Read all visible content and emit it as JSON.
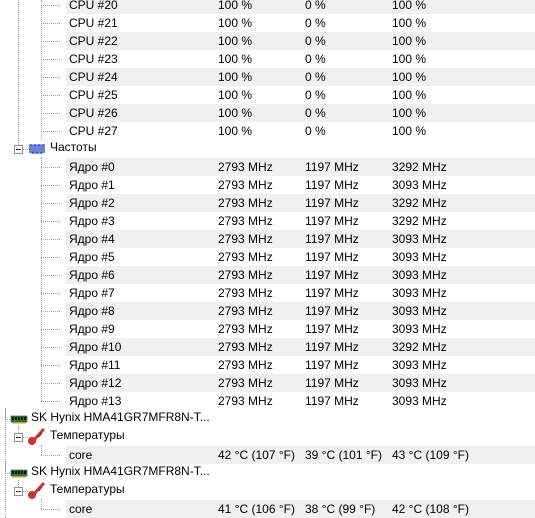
{
  "cpu_rows": [
    {
      "name": "CPU #20",
      "v1": "100 %",
      "v2": "0 %",
      "v3": "100 %"
    },
    {
      "name": "CPU #21",
      "v1": "100 %",
      "v2": "0 %",
      "v3": "100 %"
    },
    {
      "name": "CPU #22",
      "v1": "100 %",
      "v2": "0 %",
      "v3": "100 %"
    },
    {
      "name": "CPU #23",
      "v1": "100 %",
      "v2": "0 %",
      "v3": "100 %"
    },
    {
      "name": "CPU #24",
      "v1": "100 %",
      "v2": "0 %",
      "v3": "100 %"
    },
    {
      "name": "CPU #25",
      "v1": "100 %",
      "v2": "0 %",
      "v3": "100 %"
    },
    {
      "name": "CPU #26",
      "v1": "100 %",
      "v2": "0 %",
      "v3": "100 %"
    },
    {
      "name": "CPU #27",
      "v1": "100 %",
      "v2": "0 %",
      "v3": "100 %"
    }
  ],
  "clocks": {
    "label": "Частоты",
    "icon": "frequency-icon",
    "rows": [
      {
        "name": "Ядро #0",
        "v1": "2793 MHz",
        "v2": "1197 MHz",
        "v3": "3292 MHz"
      },
      {
        "name": "Ядро #1",
        "v1": "2793 MHz",
        "v2": "1197 MHz",
        "v3": "3093 MHz"
      },
      {
        "name": "Ядро #2",
        "v1": "2793 MHz",
        "v2": "1197 MHz",
        "v3": "3292 MHz"
      },
      {
        "name": "Ядро #3",
        "v1": "2793 MHz",
        "v2": "1197 MHz",
        "v3": "3292 MHz"
      },
      {
        "name": "Ядро #4",
        "v1": "2793 MHz",
        "v2": "1197 MHz",
        "v3": "3093 MHz"
      },
      {
        "name": "Ядро #5",
        "v1": "2793 MHz",
        "v2": "1197 MHz",
        "v3": "3093 MHz"
      },
      {
        "name": "Ядро #6",
        "v1": "2793 MHz",
        "v2": "1197 MHz",
        "v3": "3093 MHz"
      },
      {
        "name": "Ядро #7",
        "v1": "2793 MHz",
        "v2": "1197 MHz",
        "v3": "3093 MHz"
      },
      {
        "name": "Ядро #8",
        "v1": "2793 MHz",
        "v2": "1197 MHz",
        "v3": "3093 MHz"
      },
      {
        "name": "Ядро #9",
        "v1": "2793 MHz",
        "v2": "1197 MHz",
        "v3": "3093 MHz"
      },
      {
        "name": "Ядро #10",
        "v1": "2793 MHz",
        "v2": "1197 MHz",
        "v3": "3292 MHz"
      },
      {
        "name": "Ядро #11",
        "v1": "2793 MHz",
        "v2": "1197 MHz",
        "v3": "3093 MHz"
      },
      {
        "name": "Ядро #12",
        "v1": "2793 MHz",
        "v2": "1197 MHz",
        "v3": "3093 MHz"
      },
      {
        "name": "Ядро #13",
        "v1": "2793 MHz",
        "v2": "1197 MHz",
        "v3": "3093 MHz"
      }
    ]
  },
  "memory_modules": [
    {
      "label": "SK Hynix HMA41GR7MFR8N-T...",
      "icon": "ram-module-icon",
      "temps_label": "Температуры",
      "temps_icon": "thermometer-icon",
      "rows": [
        {
          "name": "core",
          "v1": "42 °C  (107 °F)",
          "v2": "39 °C  (101 °F)",
          "v3": "43 °C  (109 °F)"
        }
      ]
    },
    {
      "label": "SK Hynix HMA41GR7MFR8N-T...",
      "icon": "ram-module-icon",
      "temps_label": "Температуры",
      "temps_icon": "thermometer-icon",
      "rows": [
        {
          "name": "core",
          "v1": "41 °C  (106 °F)",
          "v2": "38 °C  (99 °F)",
          "v3": "42 °C  (108 °F)"
        }
      ]
    }
  ],
  "colors": {
    "row_shade": "#f0f0f0",
    "tree_lines": "#a0a0a0",
    "ram_green": "#2e7d32",
    "thermo_red": "#d32f2f",
    "freq_blue": "#1a3fb8"
  }
}
